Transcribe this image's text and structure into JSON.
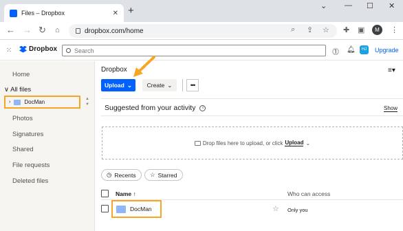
{
  "browser": {
    "tab_title": "Files – Dropbox",
    "url": "dropbox.com/home",
    "profile_initial": "M",
    "new_tab": "+"
  },
  "header": {
    "logo_text": "Dropbox",
    "search_placeholder": "Search",
    "user_initials": "HJ",
    "upgrade_label": "Upgrade"
  },
  "sidebar": {
    "home": "Home",
    "all_files": "All files",
    "tree_folder": "DocMan",
    "photos": "Photos",
    "signatures": "Signatures",
    "shared": "Shared",
    "file_requests": "File requests",
    "deleted_files": "Deleted files"
  },
  "main": {
    "breadcrumb": "Dropbox",
    "upload_label": "Upload",
    "create_label": "Create",
    "more_label": "•••",
    "suggested_title": "Suggested from your activity",
    "show_label": "Show",
    "drop_text": "Drop files here to upload, or click",
    "drop_upload": "Upload",
    "recents_label": "Recents",
    "starred_label": "Starred",
    "col_name": "Name",
    "col_access": "Who can access",
    "rows": [
      {
        "name": "DocMan",
        "access": "Only you"
      }
    ]
  },
  "colors": {
    "accent": "#0061fe",
    "highlight": "#f5a623"
  }
}
